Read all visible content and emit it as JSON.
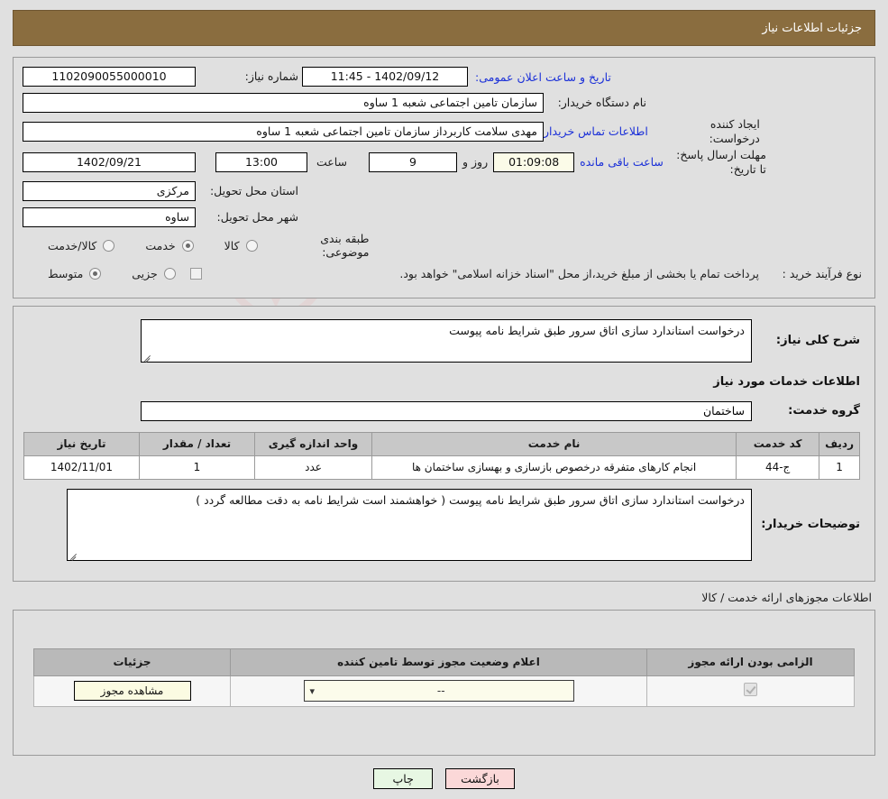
{
  "header": {
    "title": "جزئیات اطلاعات نیاز",
    "bg": "#8a6d3f"
  },
  "watermark": {
    "text": "AnaTender.net"
  },
  "top_form": {
    "labels": {
      "need_number": "شماره نیاز:",
      "buyer_org": "نام دستگاه خریدار:",
      "request_creator": "ایجاد کننده درخواست:",
      "response_deadline": "مهلت ارسال پاسخ: تا تاریخ:",
      "delivery_province": "استان محل تحویل:",
      "delivery_city": "شهر محل تحویل:",
      "subject_category": "طبقه بندی موضوعی:",
      "purchase_process_type": "نوع فرآیند خرید :",
      "public_announce": "تاریخ و ساعت اعلان عمومی:",
      "hour": "ساعت",
      "days_and": "روز و",
      "hours_remaining": "ساعت باقی مانده",
      "buyer_contact_link": "اطلاعات تماس خریدار"
    },
    "values": {
      "need_number": "1102090055000010",
      "buyer_org": "سازمان تامین اجتماعی شعبه 1 ساوه",
      "request_creator": "مهدی سلامت کاربرداز سازمان تامین اجتماعی شعبه 1 ساوه",
      "deadline_date": "1402/09/21",
      "deadline_time": "13:00",
      "days_left": "9",
      "time_left": "01:09:08",
      "public_announce": "1402/09/12 - 11:45",
      "delivery_province": "مرکزی",
      "delivery_city": "ساوه"
    },
    "subject_category_options": [
      {
        "label": "کالا",
        "selected": false
      },
      {
        "label": "خدمت",
        "selected": true
      },
      {
        "label": "کالا/خدمت",
        "selected": false
      }
    ],
    "process_type_options": [
      {
        "label": "جزیی",
        "selected": false
      },
      {
        "label": "متوسط",
        "selected": true
      }
    ],
    "treasury_checkbox": {
      "checked": false,
      "note": "پرداخت تمام یا بخشی از مبلغ خرید،از محل \"اسناد خزانه اسلامی\" خواهد بود."
    }
  },
  "middle": {
    "need_summary_label": "شرح کلی نیاز:",
    "need_summary_value": "درخواست استاندارد سازی اتاق سرور طبق شرایط نامه پیوست",
    "services_info_heading": "اطلاعات خدمات مورد نیاز",
    "service_group_label": "گروه خدمت:",
    "service_group_value": "ساختمان",
    "items_table": {
      "columns": [
        "ردیف",
        "کد خدمت",
        "نام خدمت",
        "واحد اندازه گیری",
        "تعداد / مقدار",
        "تاریخ نیاز"
      ],
      "rows": [
        {
          "row": "1",
          "service_code": "ج-44",
          "service_name": "انجام کارهای متفرقه درخصوص بازسازی و بهسازی ساختمان ها",
          "unit": "عدد",
          "quantity": "1",
          "need_date": "1402/11/01"
        }
      ]
    },
    "buyer_notes_label": "توضیحات خریدار:",
    "buyer_notes_value": "درخواست استاندارد سازی اتاق سرور طبق شرایط نامه پیوست ( خواهشمند است شرایط نامه به دقت مطالعه گردد )"
  },
  "permits": {
    "section_title": "اطلاعات مجوزهای ارائه خدمت / کالا",
    "columns": [
      "الزامی بودن ارائه مجوز",
      "اعلام وضعیت مجوز توسط تامین کننده",
      "جزئیات"
    ],
    "rows": [
      {
        "required": true,
        "status_value": "--",
        "details_button": "مشاهده مجوز"
      }
    ]
  },
  "footer": {
    "back_button": "بازگشت",
    "print_button": "چاپ"
  }
}
